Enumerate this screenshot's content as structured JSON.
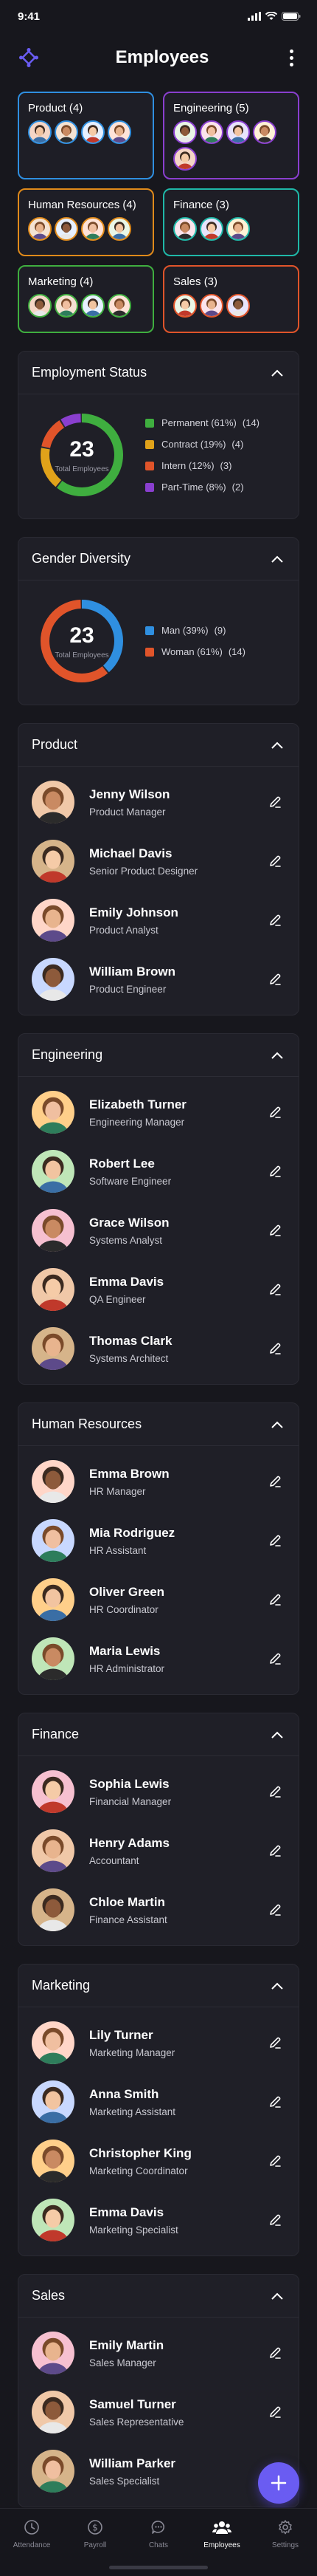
{
  "status_bar": {
    "time": "9:41"
  },
  "header": {
    "title": "Employees"
  },
  "colors": {
    "accent": "#6a5cf2",
    "product": "#2f8fe0",
    "engineering": "#8a3fcf",
    "human_resources": "#e08a1a",
    "finance": "#1fb8a8",
    "marketing": "#3fae3f",
    "sales": "#e0542a",
    "permanent": "#3fae3f",
    "contract": "#e0a21a",
    "intern": "#e0542a",
    "part_time": "#8a3fcf",
    "man": "#2f8fe0",
    "woman": "#e0542a"
  },
  "departments": [
    {
      "label": "Product (4)",
      "color": "#2f8fe0",
      "avatar_count": 4
    },
    {
      "label": "Engineering (5)",
      "color": "#8a3fcf",
      "avatar_count": 5
    },
    {
      "label": "Human Resources (4)",
      "color": "#e08a1a",
      "avatar_count": 4
    },
    {
      "label": "Finance (3)",
      "color": "#1fb8a8",
      "avatar_count": 3
    },
    {
      "label": "Marketing (4)",
      "color": "#3fae3f",
      "avatar_count": 4
    },
    {
      "label": "Sales (3)",
      "color": "#e0542a",
      "avatar_count": 3
    }
  ],
  "employment_status": {
    "title": "Employment Status",
    "total": "23",
    "total_label": "Total Employees",
    "chart_data": {
      "type": "pie",
      "categories": [
        "Permanent",
        "Contract",
        "Intern",
        "Part-Time"
      ],
      "values": [
        14,
        4,
        3,
        2
      ],
      "percents": [
        61,
        19,
        12,
        8
      ],
      "colors": [
        "#3fae3f",
        "#e0a21a",
        "#e0542a",
        "#8a3fcf"
      ]
    },
    "legend": [
      {
        "label": "Permanent (61%)",
        "count": "(14)"
      },
      {
        "label": "Contract (19%)",
        "count": "(4)"
      },
      {
        "label": "Intern (12%)",
        "count": "(3)"
      },
      {
        "label": "Part-Time (8%)",
        "count": "(2)"
      }
    ]
  },
  "gender_diversity": {
    "title": "Gender Diversity",
    "total": "23",
    "total_label": "Total Employees",
    "chart_data": {
      "type": "pie",
      "categories": [
        "Man",
        "Woman"
      ],
      "values": [
        9,
        14
      ],
      "percents": [
        39,
        61
      ],
      "colors": [
        "#2f8fe0",
        "#e0542a"
      ]
    },
    "legend": [
      {
        "label": "Man (39%)",
        "count": "(9)"
      },
      {
        "label": "Woman (61%)",
        "count": "(14)"
      }
    ]
  },
  "sections": [
    {
      "title": "Product",
      "employees": [
        {
          "name": "Jenny Wilson",
          "role": "Product Manager"
        },
        {
          "name": "Michael Davis",
          "role": "Senior Product Designer"
        },
        {
          "name": "Emily Johnson",
          "role": "Product Analyst"
        },
        {
          "name": "William Brown",
          "role": "Product Engineer"
        }
      ]
    },
    {
      "title": "Engineering",
      "employees": [
        {
          "name": "Elizabeth Turner",
          "role": "Engineering Manager"
        },
        {
          "name": "Robert Lee",
          "role": "Software Engineer"
        },
        {
          "name": "Grace Wilson",
          "role": "Systems Analyst"
        },
        {
          "name": "Emma Davis",
          "role": "QA Engineer"
        },
        {
          "name": "Thomas Clark",
          "role": "Systems Architect"
        }
      ]
    },
    {
      "title": "Human Resources",
      "employees": [
        {
          "name": "Emma Brown",
          "role": "HR Manager"
        },
        {
          "name": "Mia Rodriguez",
          "role": "HR Assistant"
        },
        {
          "name": "Oliver Green",
          "role": "HR Coordinator"
        },
        {
          "name": "Maria Lewis",
          "role": "HR Administrator"
        }
      ]
    },
    {
      "title": "Finance",
      "employees": [
        {
          "name": "Sophia Lewis",
          "role": "Financial Manager"
        },
        {
          "name": "Henry Adams",
          "role": "Accountant"
        },
        {
          "name": "Chloe Martin",
          "role": "Finance Assistant"
        }
      ]
    },
    {
      "title": "Marketing",
      "employees": [
        {
          "name": "Lily Turner",
          "role": "Marketing Manager"
        },
        {
          "name": "Anna Smith",
          "role": "Marketing Assistant"
        },
        {
          "name": "Christopher King",
          "role": "Marketing Coordinator"
        },
        {
          "name": "Emma Davis",
          "role": "Marketing Specialist"
        }
      ]
    },
    {
      "title": "Sales",
      "employees": [
        {
          "name": "Emily Martin",
          "role": "Sales Manager"
        },
        {
          "name": "Samuel Turner",
          "role": "Sales Representative"
        },
        {
          "name": "William Parker",
          "role": "Sales Specialist"
        }
      ]
    }
  ],
  "bottom_nav": [
    {
      "label": "Attendance",
      "icon": "clock-icon"
    },
    {
      "label": "Payroll",
      "icon": "dollar-icon"
    },
    {
      "label": "Chats",
      "icon": "chat-icon"
    },
    {
      "label": "Employees",
      "icon": "people-icon"
    },
    {
      "label": "Settings",
      "icon": "gear-icon"
    }
  ],
  "active_nav": "Employees"
}
